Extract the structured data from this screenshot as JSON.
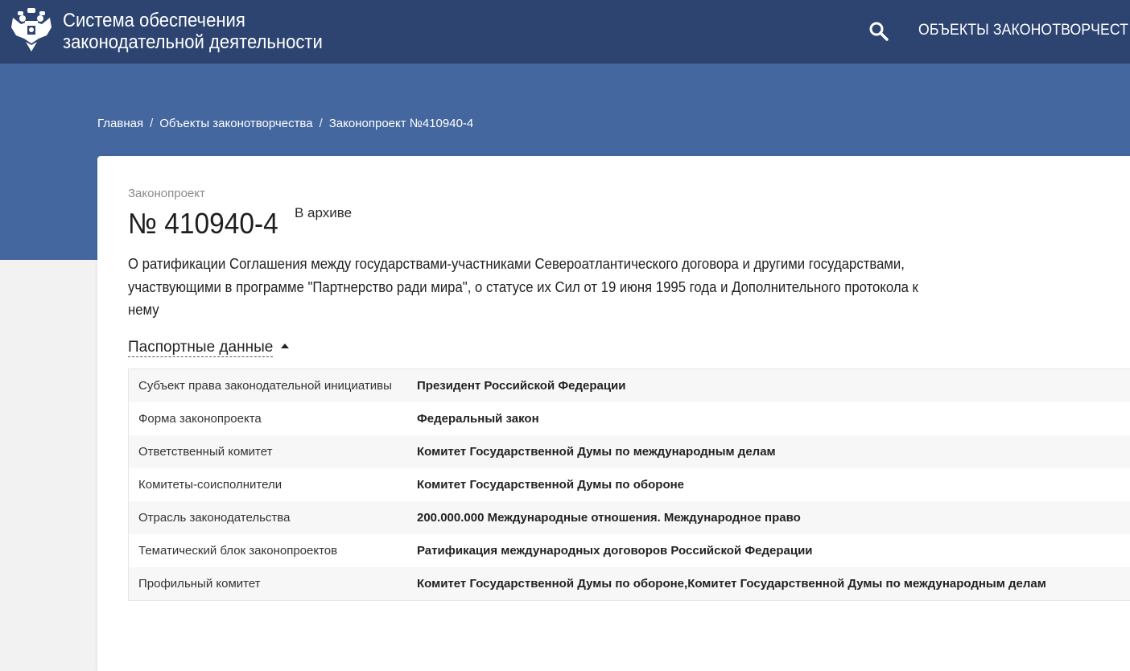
{
  "header": {
    "title_line1": "Система обеспечения",
    "title_line2": "законодательной деятельности",
    "emblem_icon": "russian-coat-of-arms-icon",
    "search_icon": "search-icon",
    "nav_link": "ОБЪЕКТЫ ЗАКОНОТВОРЧЕСТ",
    "colors": {
      "header_bg": "#2d4470",
      "band_bg": "#44679f"
    }
  },
  "breadcrumb": {
    "items": [
      "Главная",
      "Объекты законотворчества",
      "Законопроект №410940-4"
    ],
    "separator": "/"
  },
  "bill": {
    "type_label": "Законопроект",
    "number": "№ 410940-4",
    "status": "В архиве",
    "description": "О ратификации Соглашения между государствами-участниками Североатлантического договора и другими государствами, участвующими в программе \"Партнерство ради мира\", о статусе их Сил от 19 июня 1995 года и Дополнительного протокола к нему"
  },
  "passport": {
    "toggle_label": "Паспортные данные",
    "rows": [
      {
        "key": "Субъект права законодательной инициативы",
        "value": "Президент Российской Федерации"
      },
      {
        "key": "Форма законопроекта",
        "value": "Федеральный закон"
      },
      {
        "key": "Ответственный комитет",
        "value": "Комитет Государственной Думы по международным делам"
      },
      {
        "key": "Комитеты-соисполнители",
        "value": "Комитет Государственной Думы по обороне"
      },
      {
        "key": "Отрасль законодательства",
        "value": "200.000.000 Международные отношения. Международное право"
      },
      {
        "key": "Тематический блок законопроектов",
        "value": "Ратификация международных договоров Российской Федерации"
      },
      {
        "key": "Профильный комитет",
        "value": "Комитет Государственной Думы по обороне,Комитет Государственной Думы по международным делам"
      }
    ]
  }
}
